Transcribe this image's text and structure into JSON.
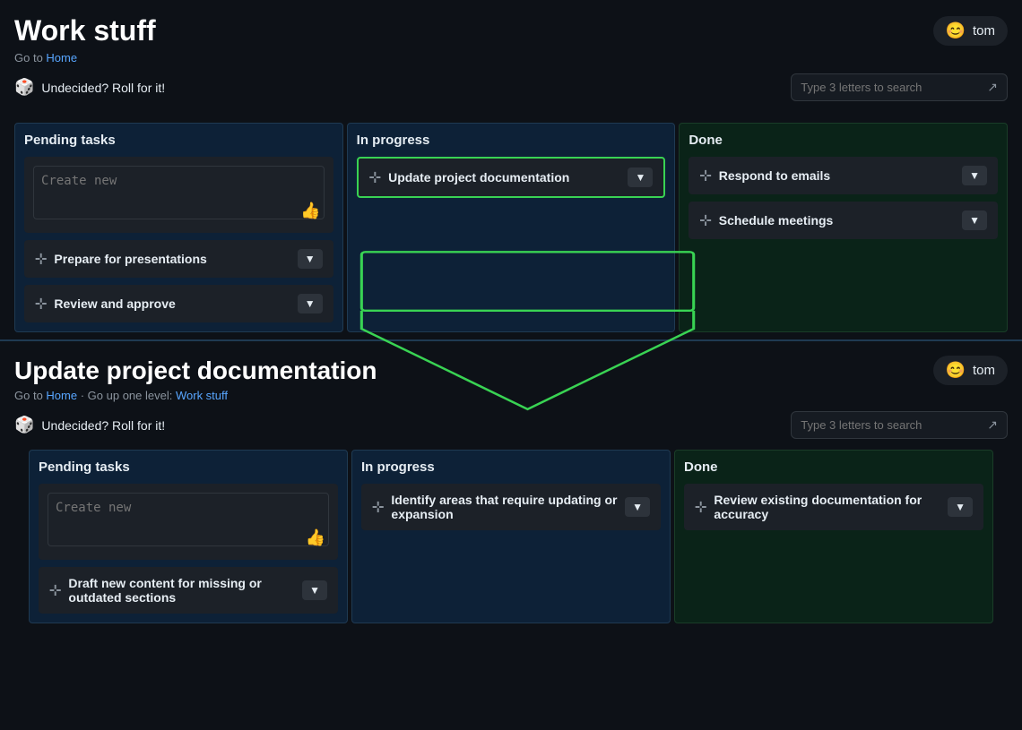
{
  "top": {
    "title": "Work stuff",
    "breadcrumb": "Go to Home",
    "breadcrumb_home": "Home",
    "roll_label": "Undecided? Roll for it!",
    "search_placeholder": "Type 3 letters to search",
    "user_name": "tom",
    "user_avatar": "😊"
  },
  "top_kanban": {
    "columns": [
      {
        "id": "pending",
        "header": "Pending tasks",
        "create_placeholder": "Create new",
        "tasks": [
          {
            "label": "Prepare for presentations"
          },
          {
            "label": "Review and approve"
          }
        ]
      },
      {
        "id": "inprogress",
        "header": "In progress",
        "tasks": [
          {
            "label": "Update project documentation",
            "highlighted": true
          }
        ]
      },
      {
        "id": "done",
        "header": "Done",
        "tasks": [
          {
            "label": "Respond to emails"
          },
          {
            "label": "Schedule meetings"
          }
        ]
      }
    ]
  },
  "bottom": {
    "title": "Update project documentation",
    "breadcrumb_home": "Home",
    "breadcrumb_parent": "Work stuff",
    "breadcrumb_text1": "Go to",
    "breadcrumb_sep1": "·",
    "breadcrumb_text2": "Go up one level:",
    "roll_label": "Undecided? Roll for it!",
    "search_placeholder": "Type 3 letters to search",
    "user_name": "tom",
    "user_avatar": "😊"
  },
  "bottom_kanban": {
    "columns": [
      {
        "id": "pending",
        "header": "Pending tasks",
        "create_placeholder": "Create new",
        "tasks": [
          {
            "label": "Draft new content for missing or outdated sections"
          }
        ]
      },
      {
        "id": "inprogress",
        "header": "In progress",
        "tasks": [
          {
            "label": "Identify areas that require updating or expansion"
          }
        ]
      },
      {
        "id": "done",
        "header": "Done",
        "tasks": [
          {
            "label": "Review existing documentation for accuracy"
          }
        ]
      }
    ]
  },
  "icons": {
    "dice": "🎲",
    "thumbs_up": "👍",
    "move": "⊹",
    "dropdown": "▼",
    "search_out": "↗"
  }
}
